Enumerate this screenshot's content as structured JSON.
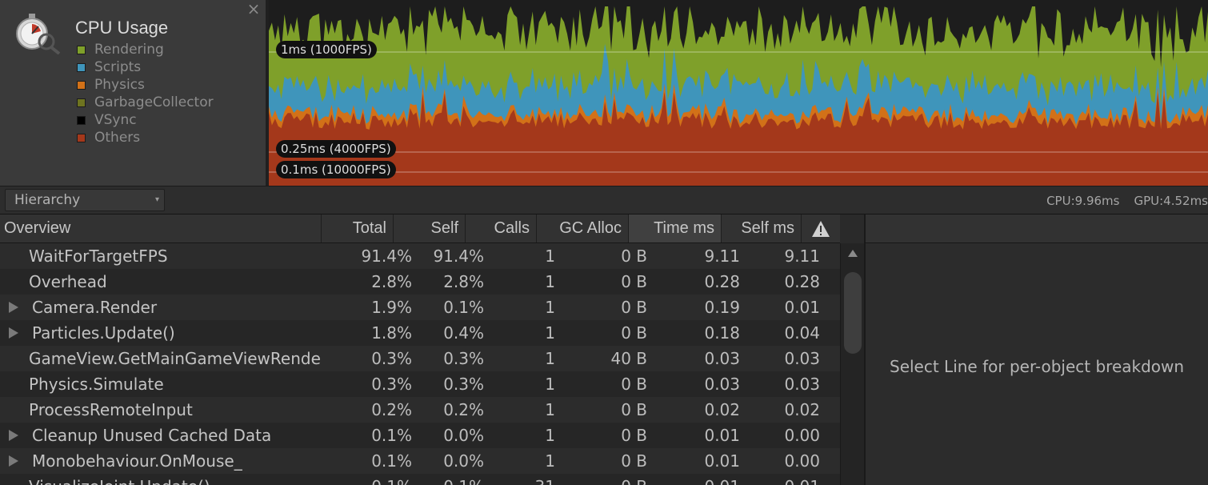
{
  "module": {
    "title": "CPU Usage",
    "close_glyph": "×",
    "icon": "stopwatch-icon",
    "legend": [
      {
        "label": "Rendering",
        "color": "#7fa02a"
      },
      {
        "label": "Scripts",
        "color": "#3f95bb"
      },
      {
        "label": "Physics",
        "color": "#d27118"
      },
      {
        "label": "GarbageCollector",
        "color": "#6e7420"
      },
      {
        "label": "VSync",
        "color": "#000000"
      },
      {
        "label": "Others",
        "color": "#a4381b"
      }
    ]
  },
  "graph": {
    "lines": [
      {
        "label": "1ms (1000FPS)",
        "ms": 1
      },
      {
        "label": "0.25ms (4000FPS)",
        "ms": 0.25
      },
      {
        "label": "0.1ms (10000FPS)",
        "ms": 0.1
      }
    ]
  },
  "toolbar": {
    "view_mode": "Hierarchy",
    "cpu_stat": "CPU:9.96ms",
    "gpu_stat": "GPU:4.52ms"
  },
  "table": {
    "headers": [
      "Overview",
      "Total",
      "Self",
      "Calls",
      "GC Alloc",
      "Time ms",
      "Self ms"
    ],
    "sort_indicator": "warning-icon",
    "rows": [
      {
        "name": "WaitForTargetFPS",
        "expandable": false,
        "total": "91.4%",
        "self": "91.4%",
        "calls": "1",
        "gc": "0 B",
        "time": "9.11",
        "selfms": "9.11"
      },
      {
        "name": "Overhead",
        "expandable": false,
        "total": "2.8%",
        "self": "2.8%",
        "calls": "1",
        "gc": "0 B",
        "time": "0.28",
        "selfms": "0.28"
      },
      {
        "name": "Camera.Render",
        "expandable": true,
        "total": "1.9%",
        "self": "0.1%",
        "calls": "1",
        "gc": "0 B",
        "time": "0.19",
        "selfms": "0.01"
      },
      {
        "name": "Particles.Update()",
        "expandable": true,
        "total": "1.8%",
        "self": "0.4%",
        "calls": "1",
        "gc": "0 B",
        "time": "0.18",
        "selfms": "0.04"
      },
      {
        "name": "GameView.GetMainGameViewRenderRect()",
        "expandable": false,
        "total": "0.3%",
        "self": "0.3%",
        "calls": "1",
        "gc": "40 B",
        "time": "0.03",
        "selfms": "0.03"
      },
      {
        "name": "Physics.Simulate",
        "expandable": false,
        "total": "0.3%",
        "self": "0.3%",
        "calls": "1",
        "gc": "0 B",
        "time": "0.03",
        "selfms": "0.03"
      },
      {
        "name": "ProcessRemoteInput",
        "expandable": false,
        "total": "0.2%",
        "self": "0.2%",
        "calls": "1",
        "gc": "0 B",
        "time": "0.02",
        "selfms": "0.02"
      },
      {
        "name": "Cleanup Unused Cached Data",
        "expandable": true,
        "total": "0.1%",
        "self": "0.0%",
        "calls": "1",
        "gc": "0 B",
        "time": "0.01",
        "selfms": "0.00"
      },
      {
        "name": "Monobehaviour.OnMouse_",
        "expandable": true,
        "total": "0.1%",
        "self": "0.0%",
        "calls": "1",
        "gc": "0 B",
        "time": "0.01",
        "selfms": "0.00"
      },
      {
        "name": "VisualizeJoint.Update()",
        "expandable": false,
        "total": "0.1%",
        "self": "0.1%",
        "calls": "31",
        "gc": "0 B",
        "time": "0.01",
        "selfms": "0.01"
      }
    ]
  },
  "detail": {
    "message": "Select Line for per-object breakdown"
  }
}
